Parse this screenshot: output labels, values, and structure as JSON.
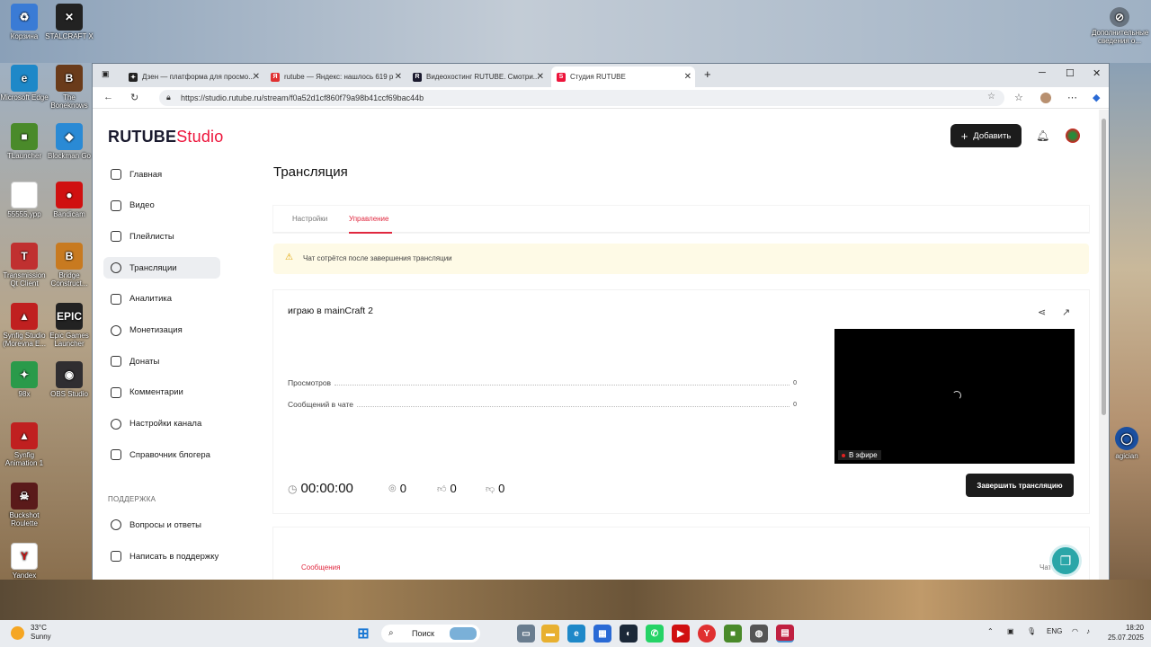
{
  "desktop": {
    "icons_left": [
      {
        "label": "Корзина",
        "color": "#3a7bd5",
        "glyph": "♻"
      },
      {
        "label": "STALCRAFT X",
        "color": "#222222",
        "glyph": "✕"
      },
      {
        "label": "Microsoft Edge",
        "color": "#1e88c8",
        "glyph": "e"
      },
      {
        "label": "The Boneknows",
        "color": "#6a3b1a",
        "glyph": "B"
      },
      {
        "label": "TLauncher",
        "color": "#4a8a2a",
        "glyph": "■"
      },
      {
        "label": "Blockman Go",
        "color": "#2a8ad5",
        "glyph": "◆"
      },
      {
        "label": "55555.ypp",
        "color": "#ffffff",
        "glyph": ""
      },
      {
        "label": "Bandicam",
        "color": "#d01010",
        "glyph": "●"
      },
      {
        "label": "Transmission Qt Client",
        "color": "#c03030",
        "glyph": "T"
      },
      {
        "label": "Bridge Construct...",
        "color": "#c87a20",
        "glyph": "B"
      },
      {
        "label": "Synfig Studio (Morevna E...",
        "color": "#c02020",
        "glyph": "▲"
      },
      {
        "label": "Epic Games Launcher",
        "color": "#222222",
        "glyph": "EPIC"
      },
      {
        "label": "98x",
        "color": "#2a9a4a",
        "glyph": "✦"
      },
      {
        "label": "OBS Studio",
        "color": "#302e31",
        "glyph": "◉"
      },
      {
        "label": "Synfig Animation 1",
        "color": "#c02020",
        "glyph": "▲"
      },
      {
        "label": "Buckshot Roulette",
        "color": "#5a1a1a",
        "glyph": "☠"
      },
      {
        "label": "Yandex",
        "color": "#ffffff",
        "glyph": "Y"
      }
    ],
    "icons_right": [
      {
        "label": "Дополнительные сведения о..."
      },
      {
        "label": "agician"
      }
    ]
  },
  "browser": {
    "tabs": [
      {
        "title": "Дзен — платформа для просмо...",
        "icon_color": "#222222"
      },
      {
        "title": "rutube — Яндекс: нашлось 619 р",
        "icon_color": "#e03030"
      },
      {
        "title": "Видеохостинг RUTUBE. Смотри...",
        "icon_color": "#1a1a2e"
      },
      {
        "title": "Студия RUTUBE",
        "icon_color": "#ed143b"
      }
    ],
    "new_tab_label": "+",
    "url": "https://studio.rutube.ru/stream/f0a52d1cf860f79a98b41ccf69bac44b"
  },
  "studio": {
    "logo_main": "RUTUBE",
    "logo_studio": "Studio",
    "add_button": "Добавить",
    "sidebar": [
      {
        "label": "Главная",
        "icon": "home-icon"
      },
      {
        "label": "Видео",
        "icon": "video-icon"
      },
      {
        "label": "Плейлисты",
        "icon": "playlist-icon"
      },
      {
        "label": "Трансляции",
        "icon": "broadcast-icon"
      },
      {
        "label": "Аналитика",
        "icon": "analytics-icon"
      },
      {
        "label": "Монетизация",
        "icon": "monetization-icon"
      },
      {
        "label": "Донаты",
        "icon": "donate-icon"
      },
      {
        "label": "Комментарии",
        "icon": "comments-icon"
      },
      {
        "label": "Настройки канала",
        "icon": "gear-icon"
      },
      {
        "label": "Справочник блогера",
        "icon": "guide-icon"
      }
    ],
    "support_heading": "ПОДДЕРЖКА",
    "support_items": [
      {
        "label": "Вопросы и ответы",
        "icon": "faq-icon"
      },
      {
        "label": "Написать в поддержку",
        "icon": "mail-icon"
      }
    ],
    "page_title": "Трансляция",
    "page_tabs": [
      "Настройки",
      "Управление"
    ],
    "warning_text": "Чат сотрётся после завершения трансляции",
    "stream": {
      "name": "играю в mainCraft 2",
      "stats": [
        {
          "label": "Просмотров",
          "value": "0"
        },
        {
          "label": "Сообщений в чате",
          "value": "0"
        }
      ],
      "live_badge": "В эфире",
      "timer": "00:00:00",
      "viewers": "0",
      "likes": "0",
      "dislikes": "0",
      "end_button": "Завершить трансляцию"
    },
    "bottom_tabs": {
      "messages": "Сообщения",
      "chat": "Чат"
    }
  },
  "taskbar": {
    "weather_temp": "33°C",
    "weather_desc": "Sunny",
    "search_placeholder": "Поиск",
    "lang": "ENG",
    "time": "18:20",
    "date": "25.07.2025"
  }
}
